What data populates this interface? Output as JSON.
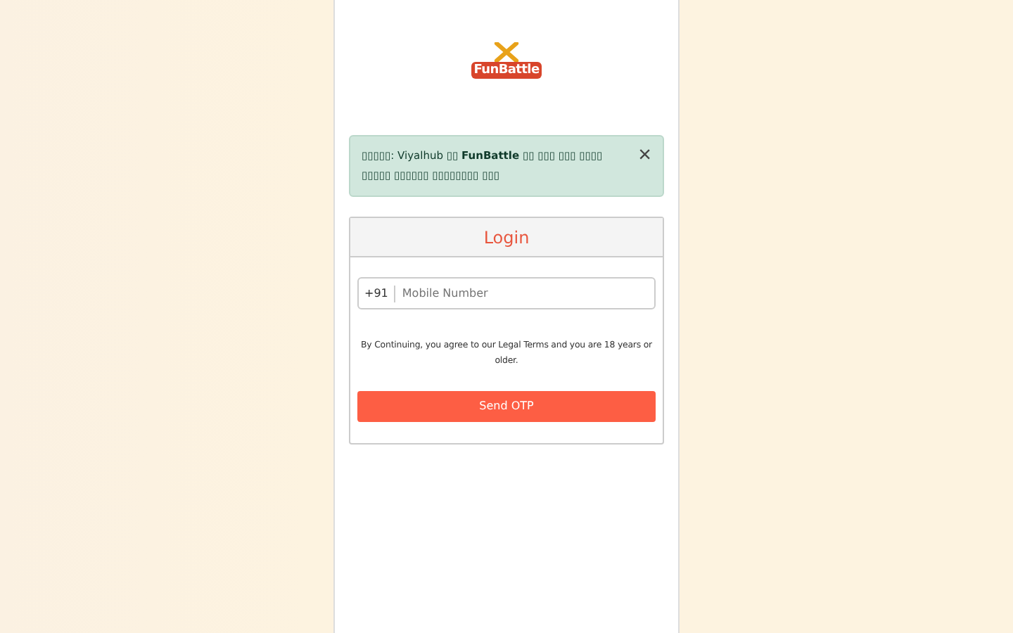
{
  "logo": {
    "text": "FunBattle"
  },
  "alert": {
    "text": "▯▯▯▯▯: Viyalhub ▯▯ **FunBattle** ▯▯ ▯▯▯ ▯▯▯ ▯▯▯▯ ▯▯▯▯▯ ▯▯▯▯▯▯ ▯▯▯▯▯▯▯▯ ▯▯▯",
    "close": "×"
  },
  "login": {
    "title": "Login",
    "country_code": "+91",
    "phone_placeholder": "Mobile Number",
    "terms": "By Continuing, you agree to our Legal Terms and you are 18 years or older.",
    "button": "Send OTP"
  }
}
